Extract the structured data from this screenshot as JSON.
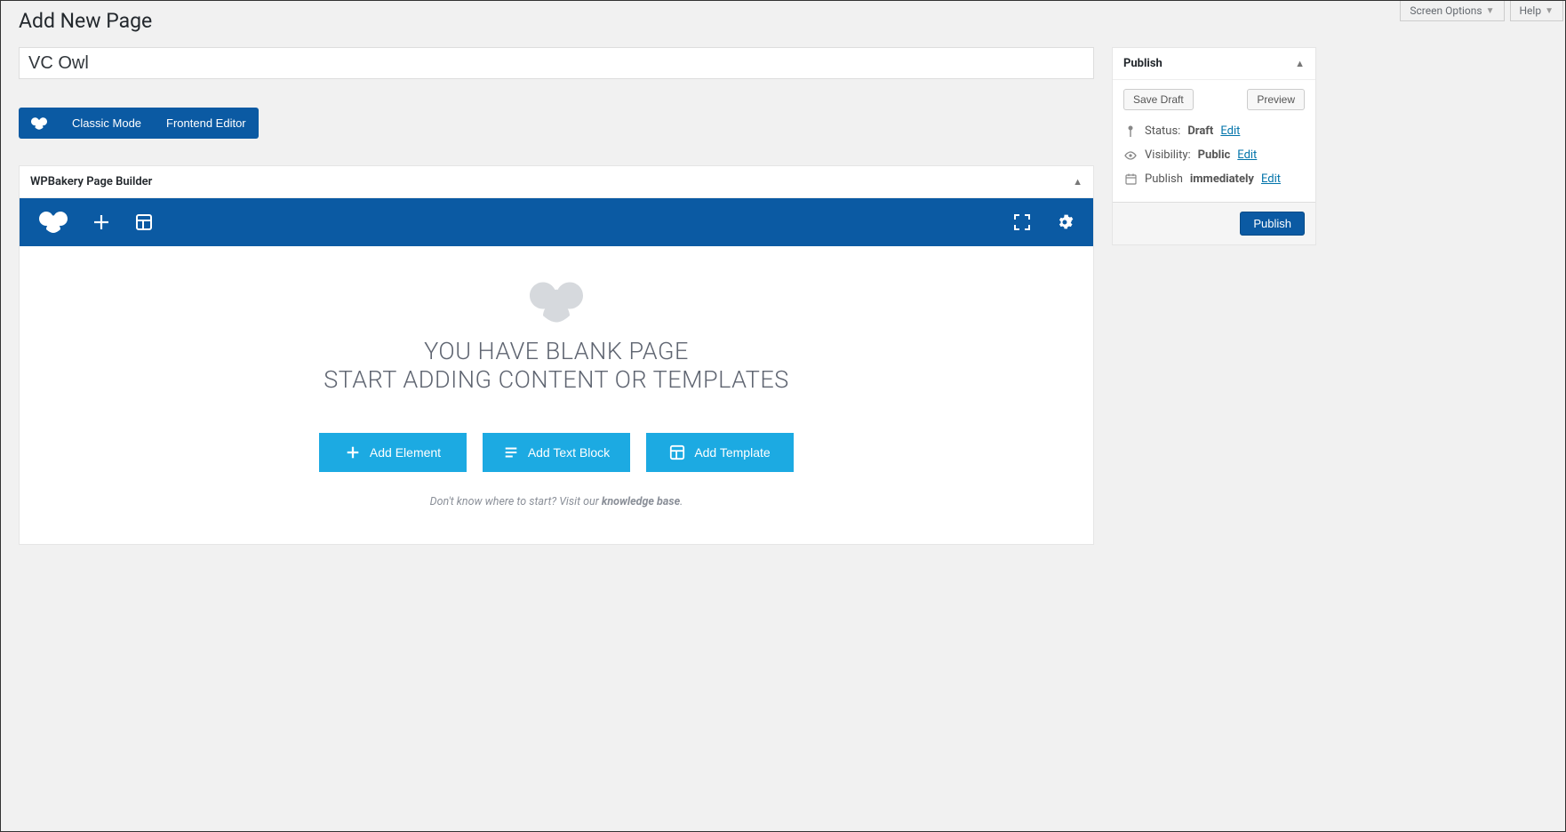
{
  "topTabs": {
    "screenOptions": "Screen Options",
    "help": "Help"
  },
  "page": {
    "heading": "Add New Page",
    "titleValue": "VC Owl"
  },
  "modeButtons": {
    "classic": "Classic Mode",
    "frontend": "Frontend Editor"
  },
  "builder": {
    "panelTitle": "WPBakery Page Builder",
    "blankLine1": "YOU HAVE BLANK PAGE",
    "blankLine2": "START ADDING CONTENT OR TEMPLATES",
    "addElement": "Add Element",
    "addTextBlock": "Add Text Block",
    "addTemplate": "Add Template",
    "helpPrefix": "Don't know where to start? Visit our ",
    "helpLinkText": "knowledge base",
    "helpSuffix": "."
  },
  "publishBox": {
    "title": "Publish",
    "saveDraft": "Save Draft",
    "preview": "Preview",
    "statusLabel": "Status:",
    "statusValue": "Draft",
    "visibilityLabel": "Visibility:",
    "visibilityValue": "Public",
    "publishLabel": "Publish",
    "publishValue": "immediately",
    "editLink": "Edit",
    "publishButton": "Publish"
  }
}
